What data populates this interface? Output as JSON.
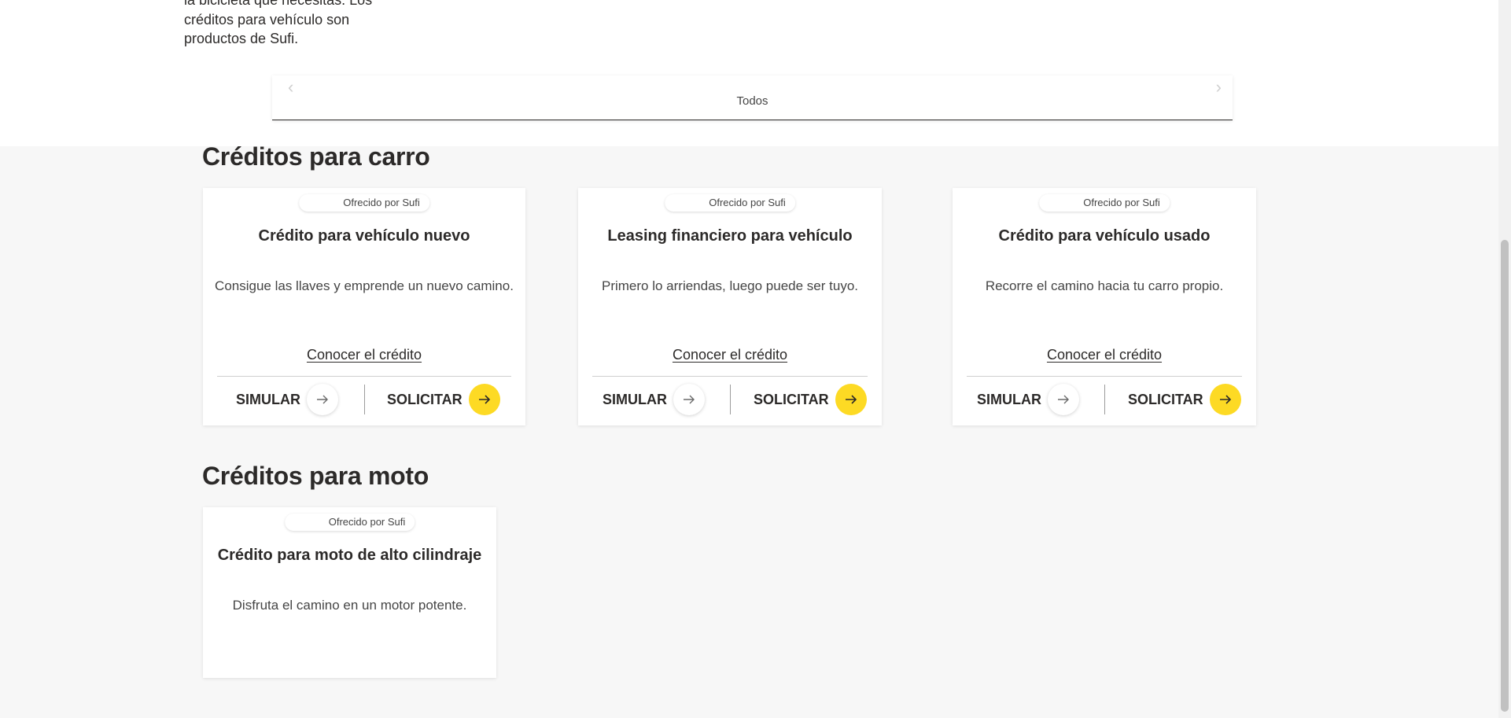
{
  "intro": {
    "line1": "la bicicleta que necesitas. Los",
    "line2": "créditos para vehículo son",
    "line3": "productos de Sufi."
  },
  "filter_tabs": {
    "active_label": "Todos",
    "prev_icon": "chevron-left-icon",
    "next_icon": "chevron-right-icon"
  },
  "sections": {
    "carro": {
      "title": "Créditos para carro",
      "cards": [
        {
          "badge": "Ofrecido por Sufi",
          "title": "Crédito para vehículo nuevo",
          "description": "Consigue las llaves y emprende un nuevo camino.",
          "link": "Conocer el crédito",
          "simular": "SIMULAR",
          "solicitar": "SOLICITAR"
        },
        {
          "badge": "Ofrecido por Sufi",
          "title": "Leasing financiero para vehículo",
          "description": "Primero lo arriendas, luego puede ser tuyo.",
          "link": "Conocer el crédito",
          "simular": "SIMULAR",
          "solicitar": "SOLICITAR"
        },
        {
          "badge": "Ofrecido por Sufi",
          "title": "Crédito para vehículo usado",
          "description": "Recorre el camino hacia tu carro propio.",
          "link": "Conocer el crédito",
          "simular": "SIMULAR",
          "solicitar": "SOLICITAR"
        }
      ]
    },
    "moto": {
      "title": "Créditos para moto",
      "cards": [
        {
          "badge": "Ofrecido por Sufi",
          "title": "Crédito para moto de alto cilindraje",
          "description": "Disfruta el camino en un motor potente."
        }
      ]
    }
  },
  "colors": {
    "accent_yellow": "#fdda24",
    "text_dark": "#2c2a29",
    "section_background": "#f7f7f7"
  },
  "icons": {
    "action_arrow": "arrow-right-icon"
  }
}
